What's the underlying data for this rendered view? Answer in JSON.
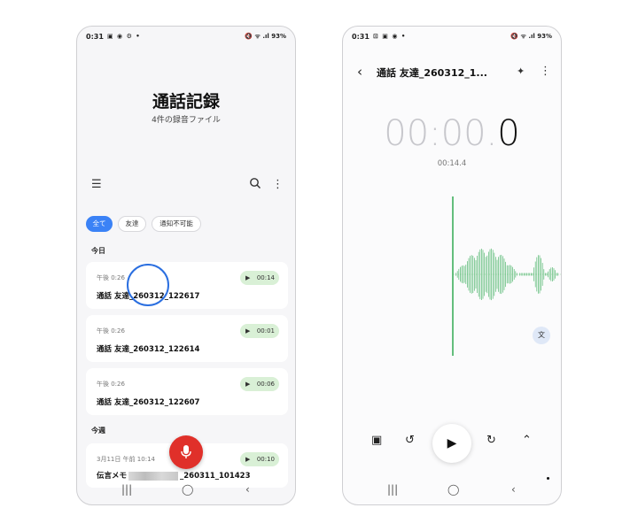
{
  "left": {
    "status": {
      "time": "0:31",
      "icons_left": "▣ ◉ ⚙ •",
      "icons_right": "🔇 ᯤ .ıl 93%"
    },
    "title": "通話記録",
    "subtitle": "4件の録音ファイル",
    "filters": [
      "全て",
      "友達",
      "通知不可能"
    ],
    "sections": {
      "today": "今日",
      "this_week": "今週"
    },
    "recordings": [
      {
        "time": "午後 0:26",
        "name": "通話 友達_260312_122617",
        "duration": "00:14"
      },
      {
        "time": "午後 0:26",
        "name": "通話 友達_260312_122614",
        "duration": "00:01"
      },
      {
        "time": "午後 0:26",
        "name": "通話 友達_260312_122607",
        "duration": "00:06"
      }
    ],
    "week_recording": {
      "time": "3月11日 午前 10:14",
      "name_prefix": "伝言メモ",
      "name_suffix": "_260311_101423",
      "duration": "00:10"
    },
    "icons": {
      "menu": "menu-icon",
      "search": "search-icon",
      "more": "more-vert-icon",
      "mic": "mic-icon"
    }
  },
  "right": {
    "status": {
      "time": "0:31",
      "icons_left": "⊡ ▣ ◉ •",
      "icons_right": "🔇 ᯤ .ıl 93%"
    },
    "title": "通話 友達_260312_1...",
    "timer_dim": "00:00.",
    "timer_bright": "0",
    "total": "00:14.4",
    "accent": "#23a447"
  }
}
